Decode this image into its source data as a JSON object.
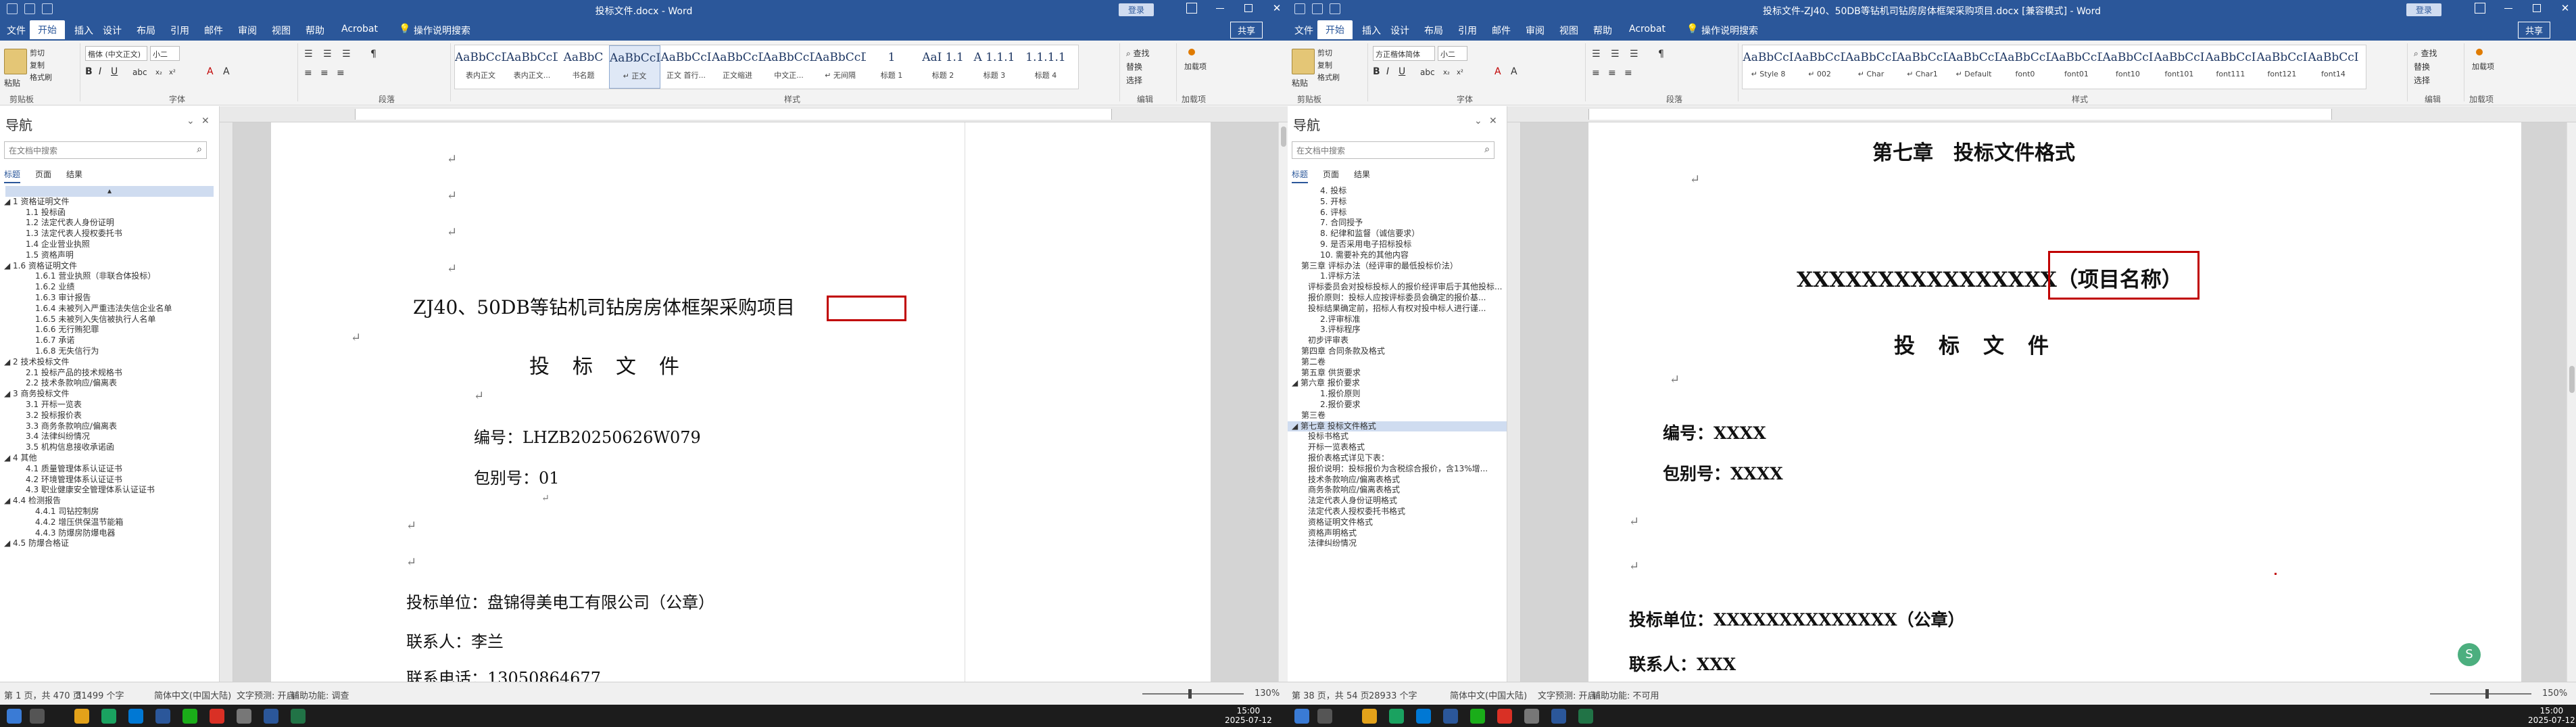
{
  "left": {
    "title": "投标文件.docx  -  Word",
    "login": "登录",
    "share": "共享",
    "tabs": [
      "文件",
      "开始",
      "插入",
      "设计",
      "布局",
      "引用",
      "邮件",
      "审阅",
      "视图",
      "帮助",
      "Acrobat",
      "操作说明搜索"
    ],
    "clipboard": {
      "paste": "粘贴",
      "cut": "剪切",
      "copy": "复制",
      "format_painter": "格式刷",
      "label": "剪贴板"
    },
    "font": {
      "name": "楷体 (中文正文)",
      "size": "小二",
      "label": "字体"
    },
    "paragraph_label": "段落",
    "styles": [
      {
        "preview": "AaBbCcD",
        "name": "表内正文"
      },
      {
        "preview": "AaBbCcD",
        "name": "表内正文..."
      },
      {
        "preview": "AaBbC",
        "name": "书名题"
      },
      {
        "preview": "AaBbCcD",
        "name": "↵ 正文"
      },
      {
        "preview": "AaBbCcI",
        "name": "正文 首行..."
      },
      {
        "preview": "AaBbCcD",
        "name": "正文缩进"
      },
      {
        "preview": "AaBbCcD",
        "name": "中文正..."
      },
      {
        "preview": "AaBbCcDc",
        "name": "↵ 无间隔"
      },
      {
        "preview": "1",
        "name": "标题 1"
      },
      {
        "preview": "AaI 1.1",
        "name": "标题 2"
      },
      {
        "preview": "A 1.1.1",
        "name": "标题 3"
      },
      {
        "preview": "1.1.1.1",
        "name": "标题 4"
      }
    ],
    "styles_label": "样式",
    "editing": {
      "find": "查找",
      "replace": "替换",
      "select": "选择",
      "label": "编辑"
    },
    "addin": {
      "label": "加载项",
      "name": "加载项"
    },
    "nav": {
      "title": "导航",
      "search_placeholder": "在文档中搜索",
      "tabs": [
        "标题",
        "页面",
        "结果"
      ],
      "items": [
        "▴",
        "◢ 1 资格证明文件",
        "1.1 投标函",
        "1.2 法定代表人身份证明",
        "1.3 法定代表人授权委托书",
        "1.4 企业营业执照",
        "1.5 资格声明",
        "◢ 1.6 资格证明文件",
        "1.6.1 营业执照（非联合体投标）",
        "1.6.2 业绩",
        "1.6.3 审计报告",
        "1.6.4 未被列入严重违法失信企业名单",
        "1.6.5 未被列入失信被执行人名单",
        "1.6.6 无行贿犯罪",
        "1.6.7 承诺",
        "1.6.8 无失信行为",
        "◢ 2 技术投标文件",
        "2.1 投标产品的技术规格书",
        "2.2 技术条款响应/偏离表",
        "◢ 3 商务投标文件",
        "3.1 开标一览表",
        "3.2 投标报价表",
        "3.3 商务条款响应/偏离表",
        "3.4 法律纠纷情况",
        "3.5 机构信息接收承诺函",
        "◢ 4 其他",
        "4.1 质量管理体系认证证书",
        "4.2 环境管理体系认证证书",
        "4.3 职业健康安全管理体系认证证书",
        "◢ 4.4 检测报告",
        "4.4.1 司钻控制房",
        "4.4.2 增压供保温节能箱",
        "4.4.3 防爆房防爆电器",
        "◢ 4.5 防爆合格证"
      ]
    },
    "doc": {
      "project_title": "ZJ40、50DB等钻机司钻房房体框架采购项目",
      "doc_title": "投　标　文　件",
      "number": "编号：LHZB20250626W079",
      "package": "包别号：01",
      "bidder": "投标单位：盘锦得美电工有限公司（公章）",
      "contact": "联系人：李兰",
      "phone": "联系电话：13050864677"
    },
    "status": {
      "page": "第 1 页，共 470 页",
      "words": "31499 个字",
      "lang": "简体中文(中国大陆)",
      "predict": "文字预测: 开启",
      "access": "辅助功能: 调查",
      "zoom": "130%"
    }
  },
  "right": {
    "title": "投标文件-ZJ40、50DB等钻机司钻房房体框架采购项目.docx [兼容模式]  -  Word",
    "login": "登录",
    "share": "共享",
    "tabs": [
      "文件",
      "开始",
      "插入",
      "设计",
      "布局",
      "引用",
      "邮件",
      "审阅",
      "视图",
      "帮助",
      "Acrobat",
      "操作说明搜索"
    ],
    "clipboard": {
      "paste": "粘贴",
      "cut": "剪切",
      "copy": "复制",
      "format_painter": "格式刷",
      "label": "剪贴板"
    },
    "font": {
      "name": "方正楷体简体",
      "size": "小二",
      "label": "字体"
    },
    "paragraph_label": "段落",
    "styles": [
      {
        "preview": "AaBbCcI",
        "name": "↵ Style 8"
      },
      {
        "preview": "AaBbCcD",
        "name": "↵ 002"
      },
      {
        "preview": "AaBbCcD",
        "name": "↵ Char"
      },
      {
        "preview": "AaBbCcD",
        "name": "↵ Char1"
      },
      {
        "preview": "AaBbCcD",
        "name": "↵ Default"
      },
      {
        "preview": "AaBbCcD",
        "name": "font0"
      },
      {
        "preview": "AaBbCcDc",
        "name": "font01"
      },
      {
        "preview": "AaBbCcI",
        "name": "font10"
      },
      {
        "preview": "AaBbCcI",
        "name": "font101"
      },
      {
        "preview": "AaBbCcI",
        "name": "font111"
      },
      {
        "preview": "AaBbCcI",
        "name": "font121"
      },
      {
        "preview": "AaBbCcI",
        "name": "font14"
      }
    ],
    "styles_label": "样式",
    "editing": {
      "find": "查找",
      "replace": "替换",
      "select": "选择",
      "label": "编辑"
    },
    "addin": {
      "label": "加载项",
      "name": "加载项"
    },
    "nav": {
      "title": "导航",
      "search_placeholder": "在文档中搜索",
      "tabs": [
        "标题",
        "页面",
        "结果"
      ],
      "items": [
        "4. 投标",
        "5. 开标",
        "6. 评标",
        "7. 合同授予",
        "8. 纪律和监督（诚信要求）",
        "9. 是否采用电子招标投标",
        "10. 需要补充的其他内容",
        "第三章 评标办法（经评审的最低投标价法）",
        "1.评标方法",
        "评标委员会对投标投标人的报价经评审后于其他投标...",
        "报价原则：投标人应按评标委员会确定的报价基...",
        "投标结果确定前，招标人有权对投中标人进行谨...",
        "2.评审标准",
        "3.评标程序",
        "初步评审表",
        "第四章 合同条款及格式",
        "第二卷",
        "第五章 供货要求",
        "◢ 第六章 报价要求",
        "1.报价原则",
        "2.报价要求",
        "第三卷",
        "◢ 第七章 投标文件格式",
        "投标书格式",
        "开标一览表格式",
        "报价表格式详见下表：",
        "报价说明：投标报价为含税综合报价，含13%增...",
        "技术条款响应/偏离表格式",
        "商务条款响应/偏离表格式",
        "法定代表人身份证明格式",
        "法定代表人授权委托书格式",
        "资格证明文件格式",
        "资格声明格式",
        "法律纠纷情况"
      ],
      "selected_index": 22
    },
    "doc": {
      "chapter": "第七章　投标文件格式",
      "project": "XXXXXXXXXXXXXXXX（项目名称）",
      "doc_title": "投　标　文　件",
      "number": "编号：XXXX",
      "package": "包别号：XXXX",
      "bidder": "投标单位：XXXXXXXXXXXXXX（公章）",
      "contact": "联系人：XXX"
    },
    "status": {
      "page": "第 38 页，共 54 页",
      "words": "28933 个字",
      "lang": "简体中文(中国大陆)",
      "predict": "文字预测: 开启",
      "access": "辅助功能: 不可用",
      "zoom": "150%"
    }
  },
  "taskbar": {
    "left_time": "15:00",
    "left_date": "2025-07-12",
    "right_time": "15:00",
    "right_date": "2025-07-12"
  },
  "colors": {
    "accent": "#2b579a",
    "highlight": "#c00000"
  }
}
